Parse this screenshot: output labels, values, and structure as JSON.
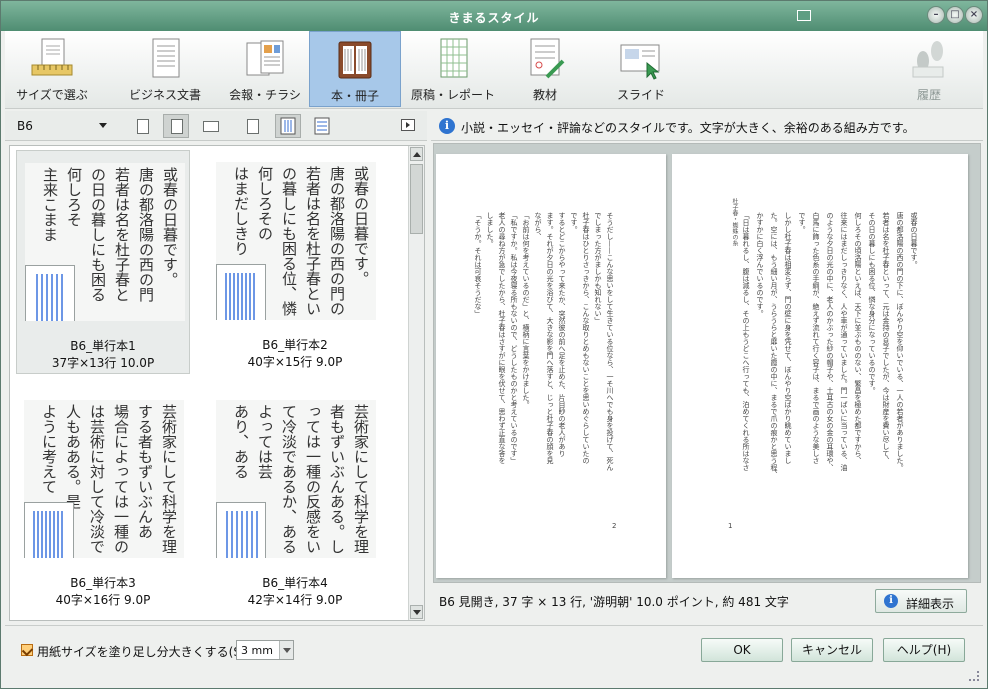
{
  "window": {
    "title": "きまるスタイル"
  },
  "toolbar": {
    "items": [
      {
        "label": "サイズで選ぶ",
        "icon": "ruler-document-icon",
        "state": "normal"
      },
      {
        "label": "ビジネス文書",
        "icon": "business-document-icon",
        "state": "normal"
      },
      {
        "label": "会報・チラシ",
        "icon": "newsletter-icon",
        "state": "normal"
      },
      {
        "label": "本・冊子",
        "icon": "book-icon",
        "state": "active"
      },
      {
        "label": "原稿・レポート",
        "icon": "manuscript-grid-icon",
        "state": "normal"
      },
      {
        "label": "教材",
        "icon": "teaching-material-icon",
        "state": "normal"
      },
      {
        "label": "スライド",
        "icon": "slide-icon",
        "state": "normal"
      },
      {
        "label": "履歴",
        "icon": "footprints-icon",
        "state": "disabled"
      }
    ]
  },
  "left_panel": {
    "size_select": {
      "value": "B6"
    },
    "view_buttons": [
      "page-stack-icon",
      "portrait-page-icon",
      "landscape-page-icon",
      "two-page-icon",
      "vertical-lines-icon",
      "horizontal-lines-icon"
    ],
    "styles": [
      {
        "name": "B6_単行本1",
        "meta": "37字×13行  10.0P",
        "columns": [
          "或春の日暮です。",
          "唐の都洛陽の西の門",
          "若者は名を杜子春と",
          "の日の暮しにも困る",
          "何しろそ",
          "主来こまま"
        ]
      },
      {
        "name": "B6_単行本2",
        "meta": "40字×15行  9.0P",
        "columns": [
          "或春の日暮です。",
          "唐の都洛陽の西の門の",
          "若者は名を杜子春とい",
          "の暮しにも困る位、憐",
          "何しろその",
          "はまだしきり"
        ]
      },
      {
        "name": "B6_単行本3",
        "meta": "40字×16行  9.0P",
        "columns": [
          "芸術家にして科学を理",
          "する者もずいぶんある。",
          "場合によっては一種の反",
          "は芸術に対して冷淡であ",
          "人もあある。是",
          "ように考えて"
        ]
      },
      {
        "name": "B6_単行本4",
        "meta": "42字×14行  9.0P",
        "columns": [
          "芸術家にして科学を理",
          "者もずいぶんある。し",
          "っては一種の反感をい",
          "て冷淡であるか、ある",
          "よっては芸",
          "あり、ある"
        ]
      }
    ]
  },
  "right_panel": {
    "description": "小説・エッセイ・評論などのスタイルです。文字が大きく、余裕のある組み方です。",
    "preview": {
      "right_page": {
        "running_head": "杜子春・蜘蛛の糸",
        "folio": "1",
        "columns": [
          "或春の日暮です。",
          "唐の都洛陽の西の門の下に、ぼんやり空を仰いでいる、一人の若者がありました。",
          "若者は名を杜子春といって、元は金持の息子でしたが、今は財産を費い尽して、",
          "その日の暮しにも困る位、憐な身分になっているのです。",
          "何しろその頃洛陽といえば、天下に並ぶもののない、繁昌を極めた都ですから、",
          "往来にはまだしっきりなく、人や車が通っていました。門一ぱいに当っている、油",
          "のような夕日の光の中に、老人のかぶった紗の帽子や、土耳古の女の金の耳環や、",
          "白馬に飾った色糸の手綱が、絶えず流れて行く容子は、まるで画のような美しさ",
          "です。",
          "しかし杜子春は相変らず、門の壁に身を凭せて、ぼんやり空ばかり眺めていまし",
          "た。空には、もう細い月が、うらうらと靡いた霞の中に、まるで爪の痕かと思う程、",
          "かすかに白く浮んでいるのです。",
          "「日は暮れるし、腹は減るし、その上もうどこへ行っても、泊めてくれる所はなさ"
        ]
      },
      "left_page": {
        "folio": "2",
        "columns": [
          "そうだし——こんな思いをして生きている位なら、一そ川へでも身を投げて、死ん",
          "でしまった方がましかも知れない」",
          "杜子春はひとりさっきから、こんな取りとめもないことを思いめぐらしていたの",
          "です。",
          "するとどこからやって来たか、突然彼の前へ足を止めた、片目眇の老人があり",
          "ます。それが夕日の光を浴びて、大きな影を門へ落すと、じっと杜子春の顔を見",
          "ながら、",
          "「お前は何を考えているのだ」と、横柄に言葉をかけました。",
          "「私ですか。私は今夜寝る所もないので、どうしたものかと考えているのです」",
          "老人の尋ね方が急でしたから、杜子春はさすがに眼を伏せて、思わず正直な答を",
          "しました。",
          "「そうか。それは可哀そうだな」"
        ]
      }
    },
    "status_text": "B6 見開き, 37 字 × 13 行, '游明朝' 10.0 ポイント, 約 481 文字",
    "detail_button": "詳細表示"
  },
  "footer": {
    "bleed_checkbox_label": "用紙サイズを塗り足し分大きくする(S)",
    "bleed_checked": true,
    "bleed_value": "3 mm",
    "ok": "OK",
    "cancel": "キャンセル",
    "help": "ヘルプ(H)"
  },
  "colors": {
    "titlebar": "#5f9e83",
    "active_tool": "#a7c8e9",
    "accent_blue": "#2f74d0",
    "stripe_blue": "#6d97e6"
  }
}
